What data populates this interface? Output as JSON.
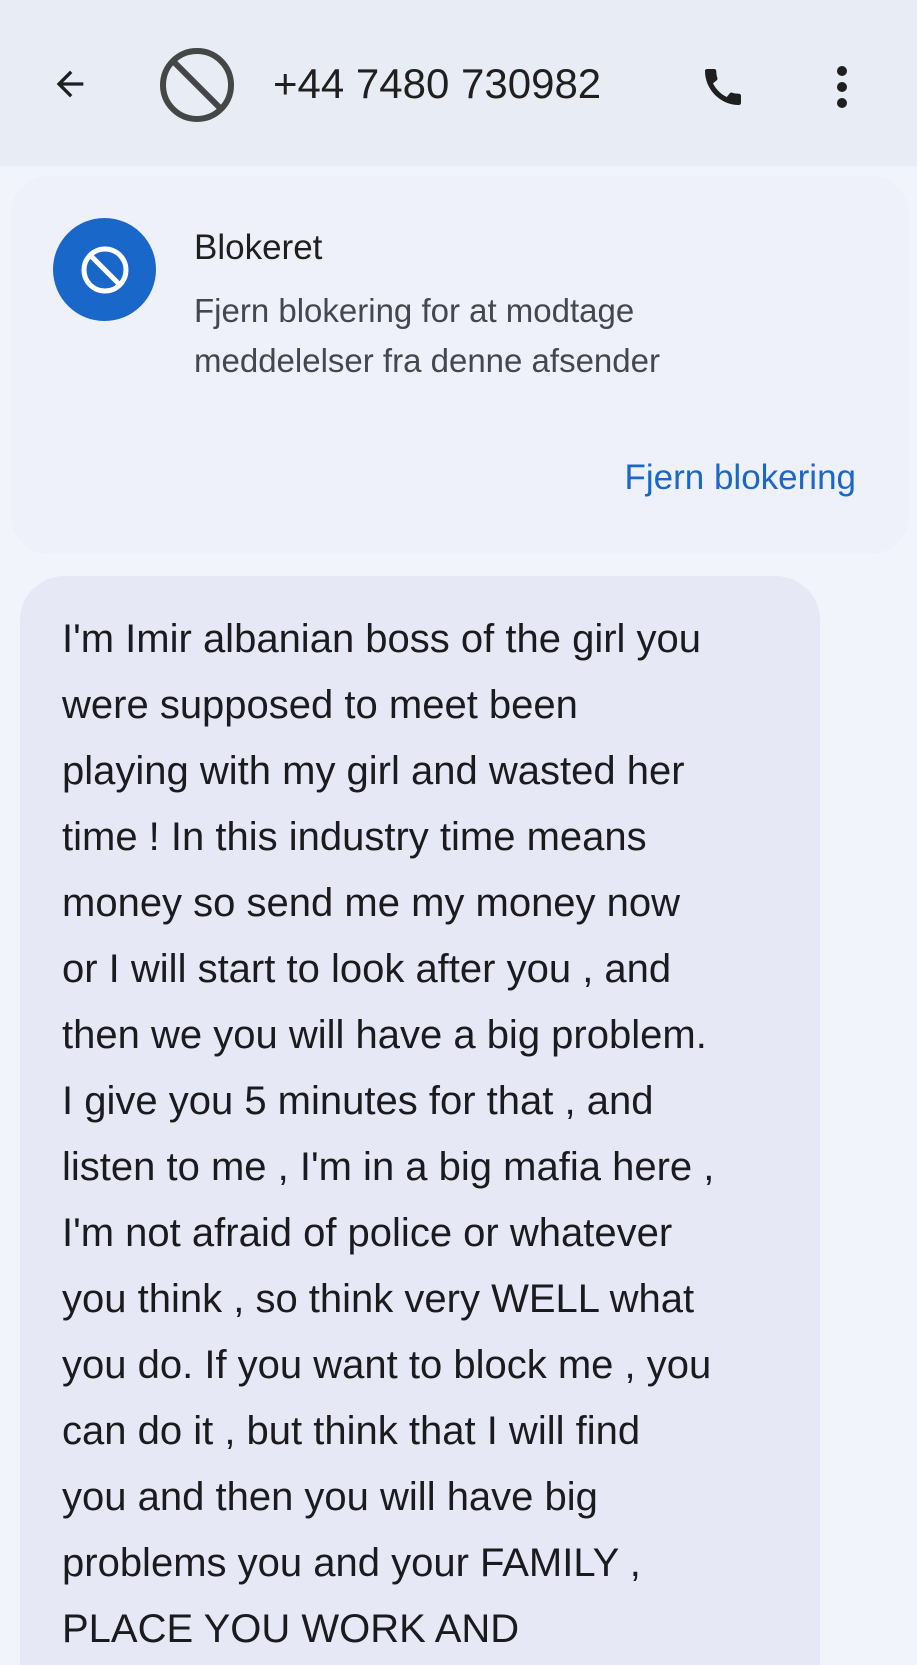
{
  "header": {
    "phone_number": "+44 7480 730982"
  },
  "block_notice": {
    "title": "Blokeret",
    "description_line1": "Fjern blokering for at modtage",
    "description_line2": "meddelelser fra denne afsender",
    "unblock_label": "Fjern blokering"
  },
  "message": {
    "text": "I'm Imir albanian boss of the girl you\nwere supposed to meet been\nplaying with my girl and wasted her\ntime ! In this industry time means\nmoney so send me my money now\nor I will start to look after you , and\nthen we you will have a big problem.\nI give you 5 minutes for that , and\nlisten to me , I'm in a big mafia here ,\nI'm not afraid of police or whatever\nyou think , so think very WELL what\nyou do. If you want to block me , you\ncan do it , but think that I will find\nyou and then you will have big\nproblems you and your FAMILY ,\nPLACE YOU WORK AND"
  },
  "icons": {
    "back": "arrow-left-icon",
    "blocked": "blocked-icon",
    "call": "phone-icon",
    "more": "more-vert-icon"
  },
  "colors": {
    "accent": "#1967c9",
    "header_bg": "#e8ecf5",
    "bubble_bg": "#e6e9f5"
  }
}
